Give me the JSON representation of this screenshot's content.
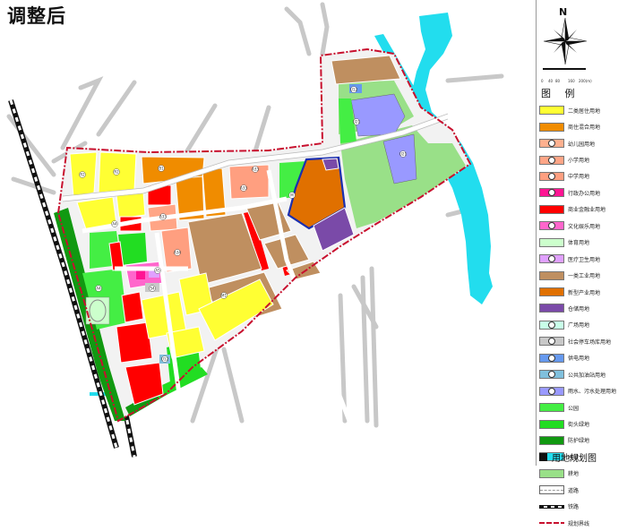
{
  "map": {
    "title": "调整后",
    "north_label": "N",
    "scale_ticks": [
      "0",
      "40",
      "80",
      "160",
      "200(m)"
    ],
    "plot_codes": {
      "r2": "R2",
      "b1": "B1",
      "a33": "A33",
      "a34": "A34",
      "a4": "A4",
      "a5": "A5",
      "m1": "M1",
      "m": "M",
      "s4": "S4",
      "u12": "U12",
      "u21": "U21"
    }
  },
  "legend": {
    "title": "图 例",
    "items": [
      {
        "label": "二类居住用地",
        "color": "#ffff33",
        "code": ""
      },
      {
        "label": "商住混合用地",
        "color": "#f08c00",
        "code": ""
      },
      {
        "label": "幼儿园用地",
        "color": "#ffb08f",
        "code": "●"
      },
      {
        "label": "小学用地",
        "color": "#ffa586",
        "code": "●"
      },
      {
        "label": "中学用地",
        "color": "#ff9f80",
        "code": "●"
      },
      {
        "label": "行政办公用地",
        "color": "#ff1493",
        "code": "●"
      },
      {
        "label": "商业金融业用地",
        "color": "#ff0000",
        "code": ""
      },
      {
        "label": "文化娱乐用地",
        "color": "#ff66cc",
        "code": "●"
      },
      {
        "label": "体育用地",
        "color": "#ccffcc",
        "code": ""
      },
      {
        "label": "医疗卫生用地",
        "color": "#e0a0ff",
        "code": "●"
      },
      {
        "label": "一类工业用地",
        "color": "#bf8f60",
        "code": ""
      },
      {
        "label": "新型产业用地",
        "color": "#e07000",
        "code": ""
      },
      {
        "label": "仓储用地",
        "color": "#7a4aa8",
        "code": ""
      },
      {
        "label": "广场用地",
        "color": "#c8ffe8",
        "code": "●"
      },
      {
        "label": "社会停车场库用地",
        "color": "#c8c8c8",
        "code": "●"
      },
      {
        "label": "供电用地",
        "color": "#6699ee",
        "code": "●"
      },
      {
        "label": "公共加油站用地",
        "color": "#80c0dd",
        "code": "●"
      },
      {
        "label": "雨水、污水处理用地",
        "color": "#9999ff",
        "code": "●"
      },
      {
        "label": "公园",
        "color": "#44ee44",
        "code": ""
      },
      {
        "label": "街头绿地",
        "color": "#22dd22",
        "code": ""
      },
      {
        "label": "防护绿地",
        "color": "#119911",
        "code": ""
      },
      {
        "label": "水域",
        "color": "#22ddee",
        "code": ""
      },
      {
        "label": "耕地",
        "color": "#99e088",
        "code": ""
      },
      {
        "label": "道路",
        "color": "#ffffff",
        "code": ""
      },
      {
        "label": "铁路",
        "color": "#ffffff",
        "code": ""
      },
      {
        "label": "规划界线",
        "color": "#ffffff",
        "code": ""
      }
    ]
  },
  "footer": {
    "label": "用地规划图"
  }
}
